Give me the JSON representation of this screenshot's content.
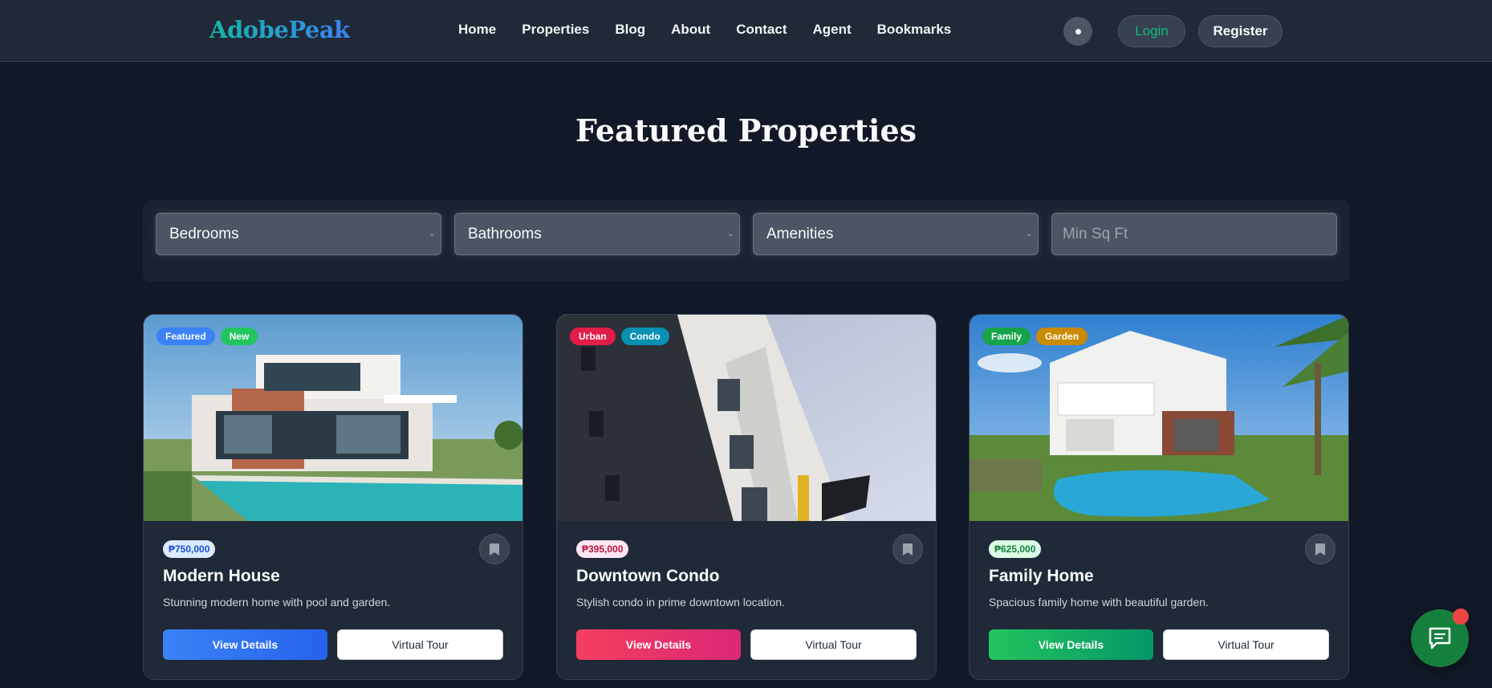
{
  "nav": {
    "brand": "AdobePeak",
    "links": [
      "Home",
      "Properties",
      "Blog",
      "About",
      "Contact",
      "Agent",
      "Bookmarks"
    ],
    "login_label": "Login",
    "register_label": "Register"
  },
  "page": {
    "title": "Featured Properties"
  },
  "filters": {
    "bedrooms": "Bedrooms",
    "bathrooms": "Bathrooms",
    "amenities": "Amenities",
    "min_sqft_placeholder": "Min Sq Ft"
  },
  "cards": [
    {
      "tags": [
        {
          "label": "Featured",
          "color": "#3b82f6"
        },
        {
          "label": "New",
          "color": "#22c55e"
        }
      ],
      "price": "₱750,000",
      "price_color": "#1d4ed8",
      "price_bg": "#dbeafe",
      "title": "Modern House",
      "description": "Stunning modern home with pool and garden.",
      "details_label": "View Details",
      "tour_label": "Virtual Tour",
      "accent": "#3b82f6"
    },
    {
      "tags": [
        {
          "label": "Urban",
          "color": "#e11d48"
        },
        {
          "label": "Condo",
          "color": "#0891b2"
        }
      ],
      "price": "₱395,000",
      "price_color": "#be123c",
      "price_bg": "#fce7f3",
      "title": "Downtown Condo",
      "description": "Stylish condo in prime downtown location.",
      "details_label": "View Details",
      "tour_label": "Virtual Tour",
      "accent": "#f43f5e"
    },
    {
      "tags": [
        {
          "label": "Family",
          "color": "#16a34a"
        },
        {
          "label": "Garden",
          "color": "#ca8a04"
        }
      ],
      "price": "₱625,000",
      "price_color": "#15803d",
      "price_bg": "#dcfce7",
      "title": "Family Home",
      "description": "Spacious family home with beautiful garden.",
      "details_label": "View Details",
      "tour_label": "Virtual Tour",
      "accent": "#22c55e"
    }
  ]
}
